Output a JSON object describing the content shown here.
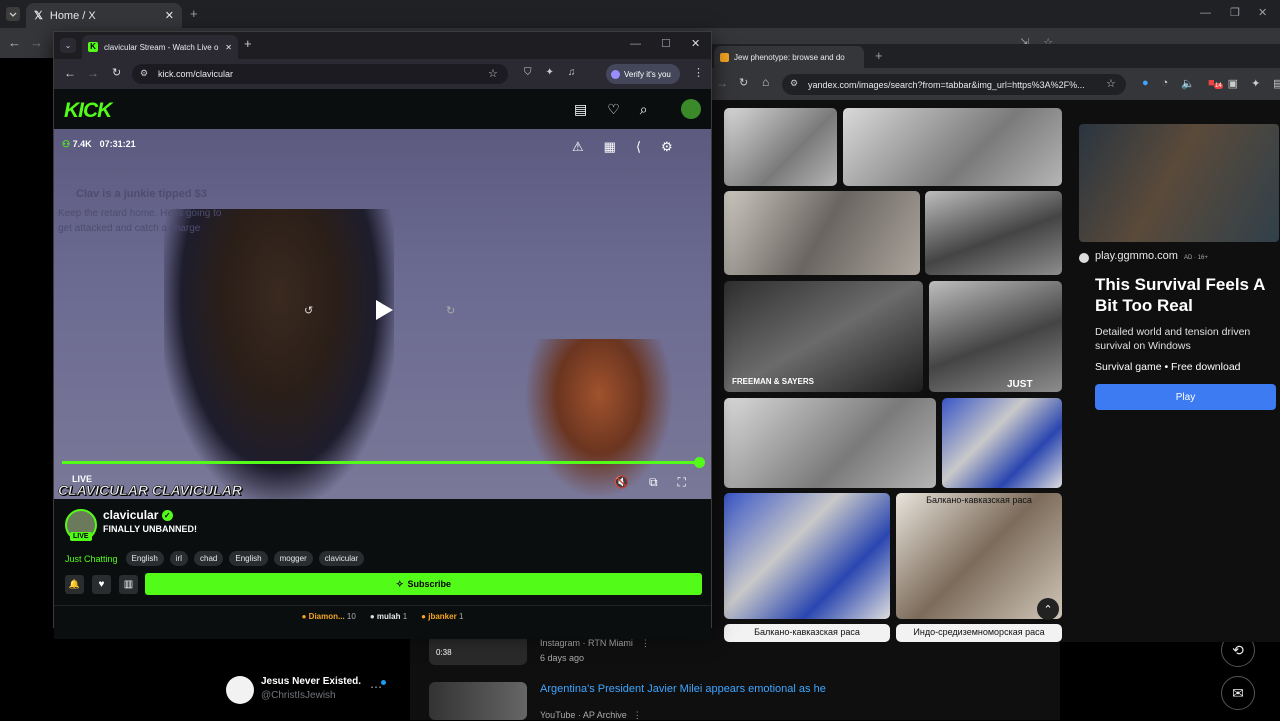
{
  "x_window": {
    "tab_title": "Home / X",
    "post_author": "Jesus Never Existed.",
    "post_handle": "@ChristIsJewish",
    "video_1_duration": "0:38",
    "video_1_meta": "Instagram · RTN Miami",
    "video_1_age": "6 days ago",
    "video_2_title": "Argentina's President Javier Milei appears emotional as he",
    "video_2_meta": "YouTube · AP Archive"
  },
  "kick_window": {
    "tab_title": "clavicular Stream - Watch Live o",
    "url": "kick.com/clavicular",
    "verify_label": "Verify it's you",
    "logo": "KICK",
    "viewers": "7.4K",
    "uptime": "07:31:21",
    "overlay_tip": "Clav is a junkie tipped $3",
    "overlay_msg": "Keep the retard home. He is going to get attacked and catch a charge",
    "live_label": "LIVE",
    "watermark": "CLAVICULAR CLAVICULAR",
    "channel_name": "clavicular",
    "stream_title": "FINALLY UNBANNED!",
    "live_badge": "LIVE",
    "category": "Just Chatting",
    "tags": [
      "English",
      "irl",
      "chad",
      "English",
      "mogger",
      "clavicular"
    ],
    "subscribe_label": "Subscribe",
    "gifters": [
      {
        "name": "Diamon...",
        "count": "10"
      },
      {
        "name": "mulah",
        "count": "1"
      },
      {
        "name": "jbanker",
        "count": "1"
      }
    ],
    "progress": 1.0
  },
  "yandex_window": {
    "tab_title": "Jew phenotype: browse and do",
    "url": "yandex.com/images/search?from=tabbar&img_url=https%3A%2F%...",
    "notif_count": "14",
    "captions": [
      "FREEMAN & SAYERS",
      "JUST",
      "Балкано-кавказская раса",
      "Балкано-кавказская раса",
      "Индо-средиземноморская раса"
    ],
    "ad": {
      "domain": "play.ggmmo.com",
      "age_tag": "AD · 16+",
      "title": "This Survival Feels A Bit Too Real",
      "description": "Detailed world and tension driven survival on Windows",
      "subline": "Survival game • Free download",
      "play_label": "Play"
    }
  },
  "colors": {
    "kick_green": "#53fc18",
    "yandex_blue": "#3d7bf2"
  }
}
